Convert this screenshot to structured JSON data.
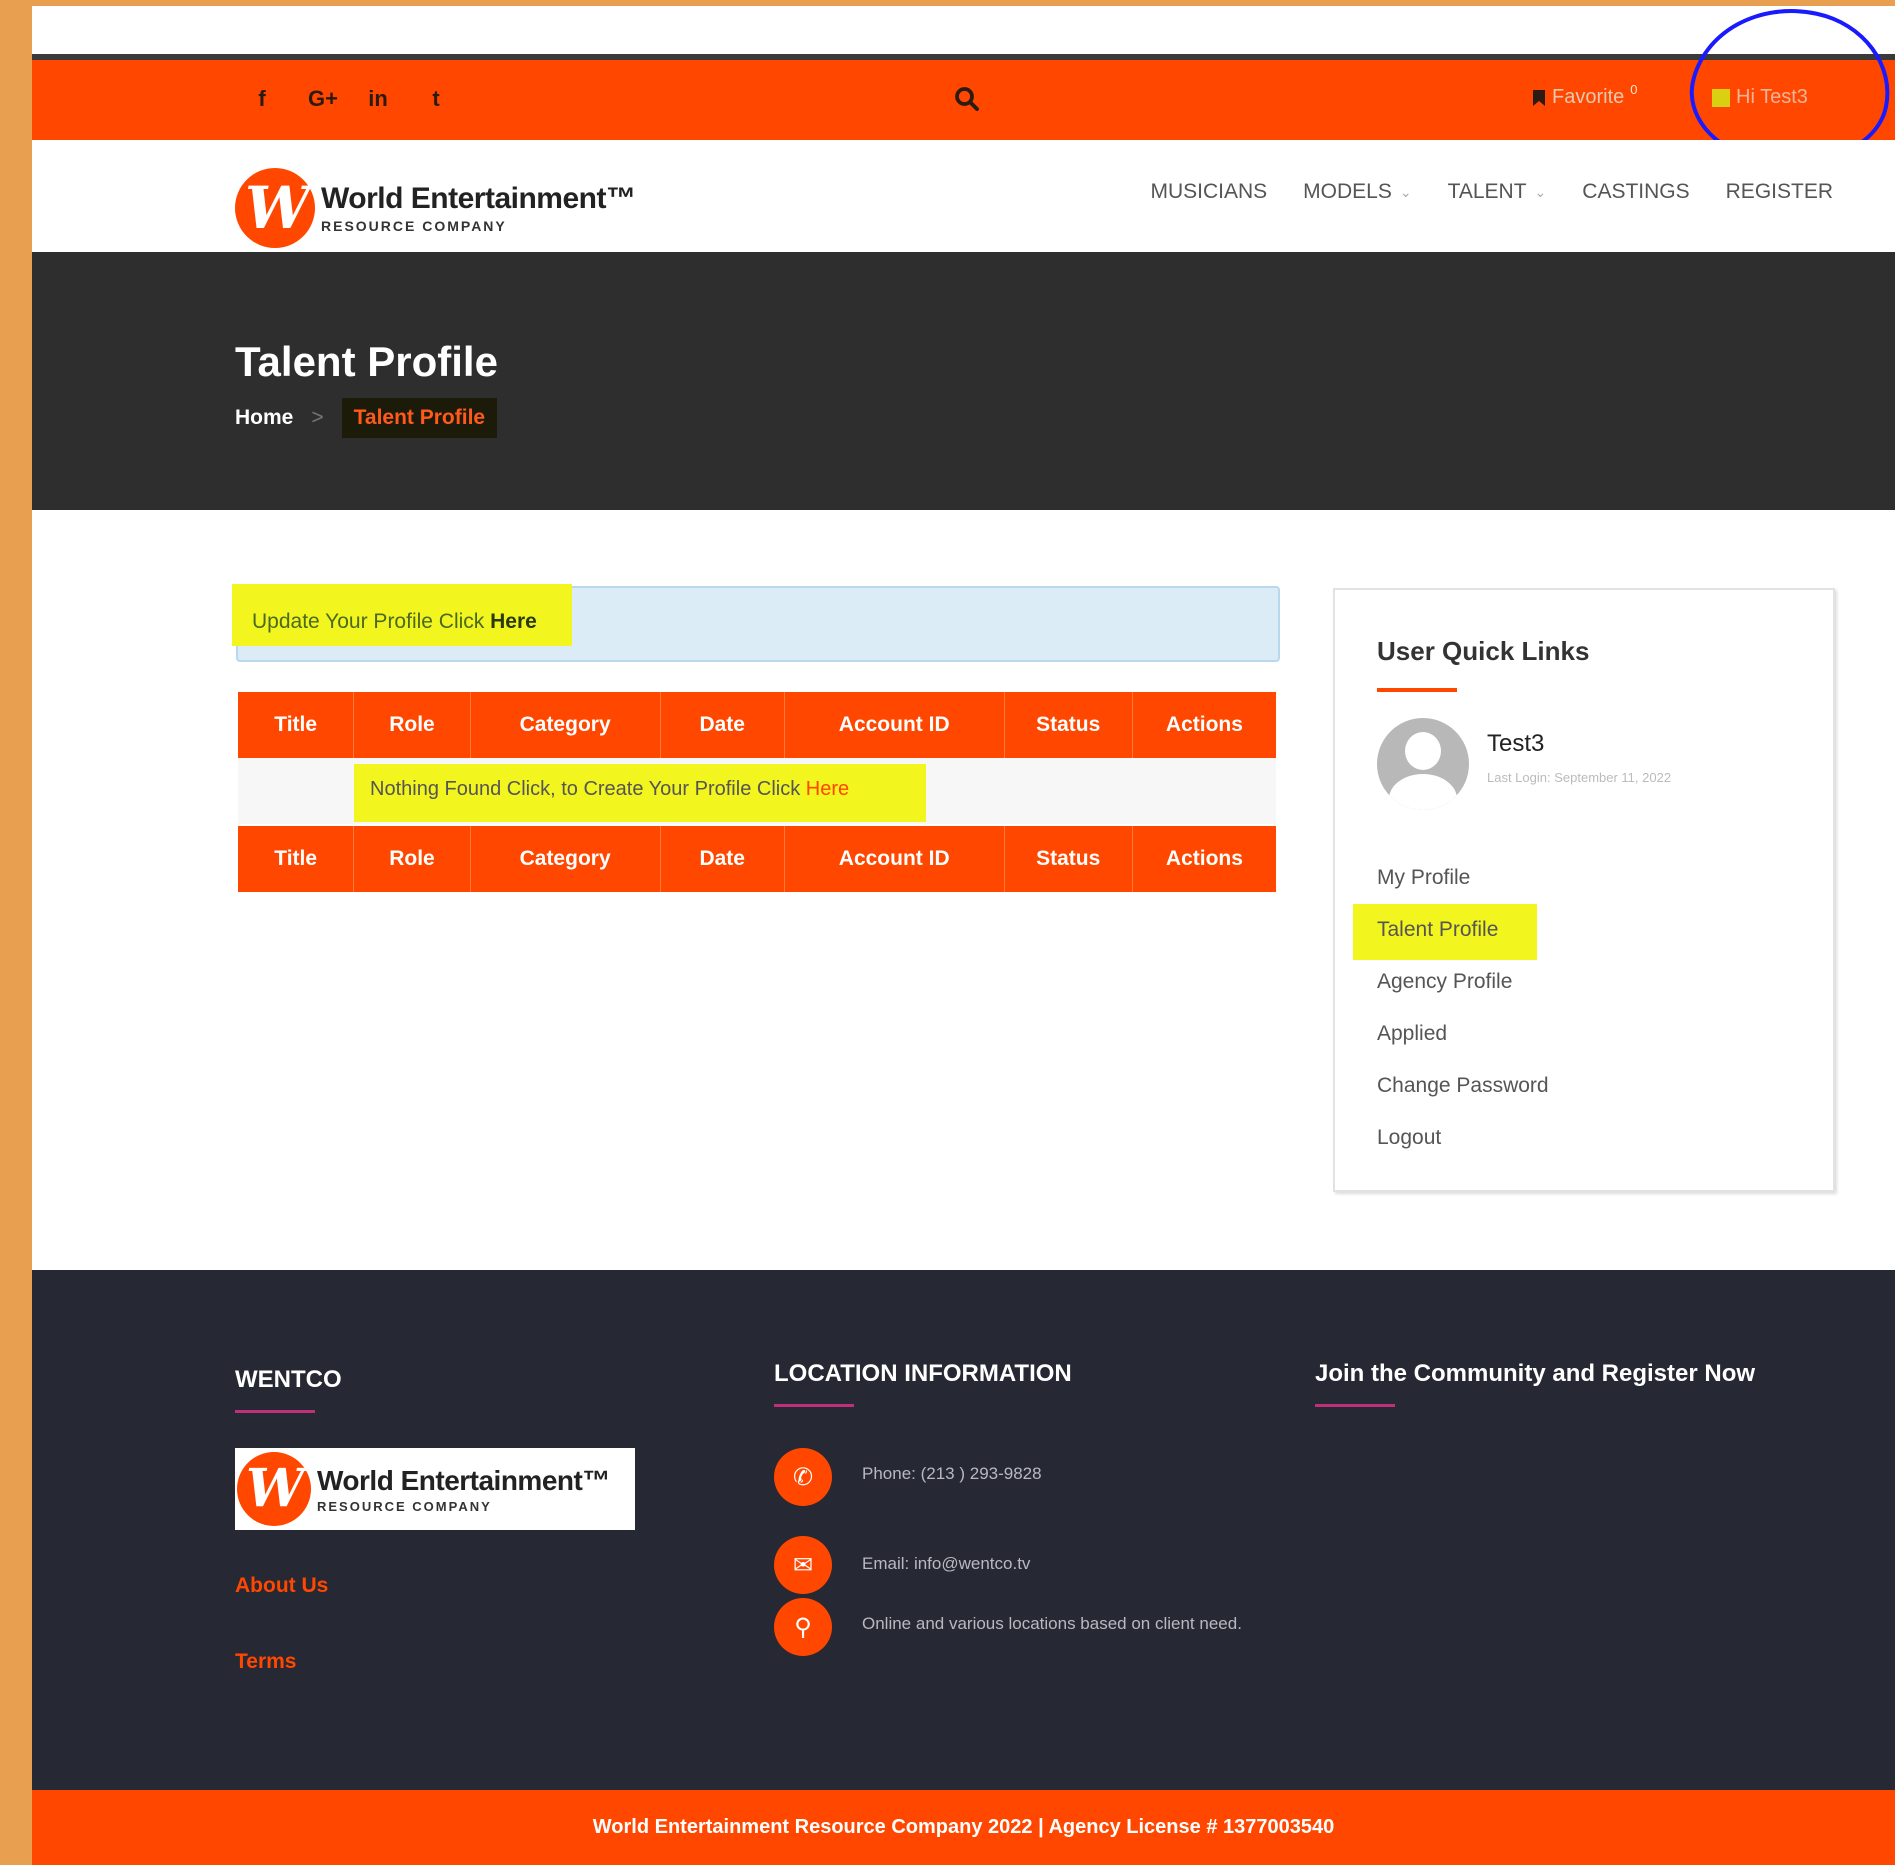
{
  "topbar": {
    "social": [
      "f",
      "G+",
      "in",
      "t"
    ],
    "favorite_label": "Favorite",
    "favorite_count": "0",
    "user_greeting": "Hi Test3"
  },
  "header": {
    "logo_title": "World Entertainment™",
    "logo_subtitle": "RESOURCE COMPANY",
    "nav": [
      "MUSICIANS",
      "MODELS",
      "TALENT",
      "CASTINGS",
      "REGISTER"
    ]
  },
  "banner": {
    "title": "Talent Profile",
    "breadcrumb_home": "Home",
    "breadcrumb_sep": ">",
    "breadcrumb_current": "Talent Profile"
  },
  "alert": {
    "text": "Update Your Profile Click ",
    "link": "Here"
  },
  "table": {
    "headers": [
      "Title",
      "Role",
      "Category",
      "Date",
      "Account ID",
      "Status",
      "Actions"
    ],
    "empty_text": "Nothing Found Click, to Create Your Profile Click ",
    "empty_link": "Here"
  },
  "sidebar": {
    "title": "User Quick Links",
    "user_name": "Test3",
    "last_login": "Last Login: September 11, 2022",
    "links": [
      "My Profile",
      "Talent Profile",
      "Agency Profile",
      "Applied",
      "Change Password",
      "Logout"
    ]
  },
  "footer": {
    "col1_title": "WENTCO",
    "about": "About Us",
    "terms": "Terms",
    "col2_title": "LOCATION INFORMATION",
    "phone": "Phone: (213 ) 293-9828",
    "email": "Email: info@wentco.tv",
    "location": "Online and various locations based on client need.",
    "col3_title": "Join the Community and Register Now",
    "copyright": "World Entertainment Resource Company 2022 | Agency License # 1377003540"
  },
  "colors": {
    "brand_orange": "#ff4700",
    "dark_banner": "#2e2e2e",
    "footer_bg": "#262834",
    "highlight_yellow": "#f2f51e",
    "annotation_blue": "#1a1aff"
  }
}
